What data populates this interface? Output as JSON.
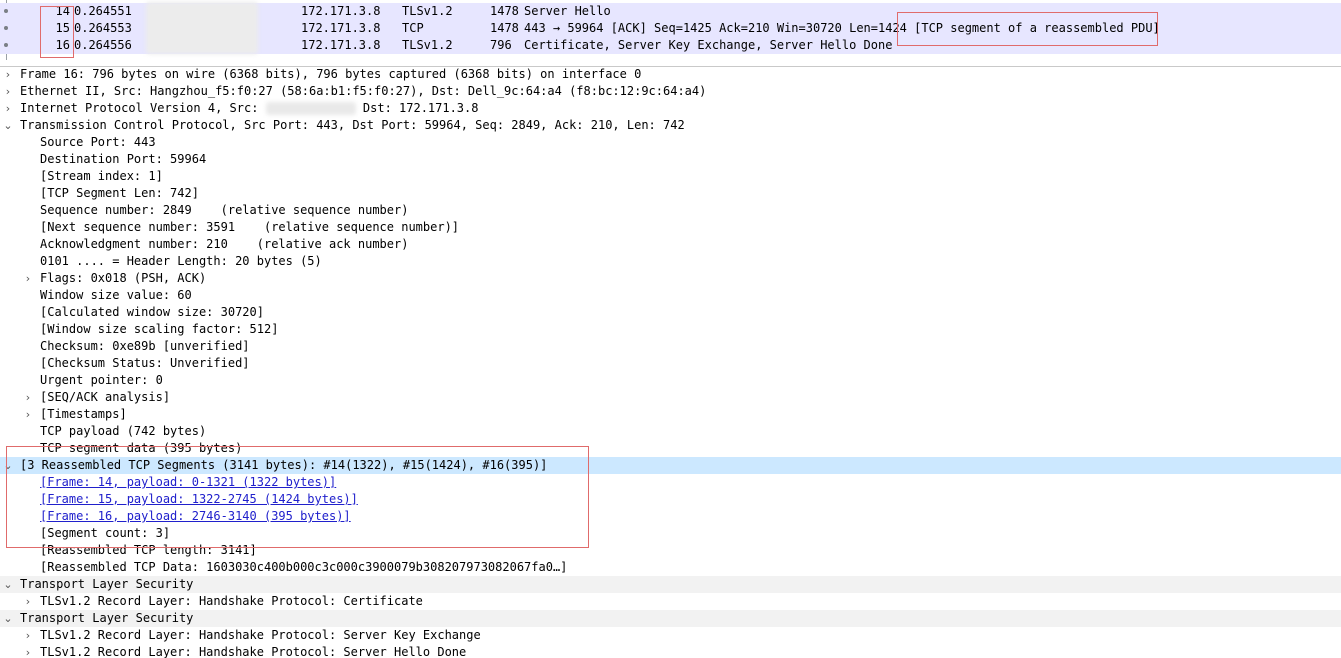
{
  "packet_list": {
    "rows": [
      {
        "no": "14",
        "time": "0.264551",
        "dst": "172.171.3.8",
        "proto": "TLSv1.2",
        "len": "1478",
        "info": "Server Hello"
      },
      {
        "no": "15",
        "time": "0.264553",
        "dst": "172.171.3.8",
        "proto": "TCP",
        "len": "1478",
        "info": "443 → 59964 [ACK] Seq=1425 Ack=210 Win=30720 Len=1424 [TCP segment of a reassembled PDU]"
      },
      {
        "no": "16",
        "time": "0.264556",
        "dst": "172.171.3.8",
        "proto": "TLSv1.2",
        "len": "796",
        "info": "Certificate, Server Key Exchange, Server Hello Done"
      }
    ]
  },
  "details": {
    "frame": "Frame 16: 796 bytes on wire (6368 bits), 796 bytes captured (6368 bits) on interface 0",
    "ethernet": "Ethernet II, Src: Hangzhou_f5:f0:27 (58:6a:b1:f5:f0:27), Dst: Dell_9c:64:a4 (f8:bc:12:9c:64:a4)",
    "ip_prefix": "Internet Protocol Version 4, Src:",
    "ip_dst": "Dst: 172.171.3.8",
    "tcp_header": "Transmission Control Protocol, Src Port: 443, Dst Port: 59964, Seq: 2849, Ack: 210, Len: 742",
    "tcp_fields": [
      "Source Port: 443",
      "Destination Port: 59964",
      "[Stream index: 1]",
      "[TCP Segment Len: 742]",
      "Sequence number: 2849    (relative sequence number)",
      "[Next sequence number: 3591    (relative sequence number)]",
      "Acknowledgment number: 210    (relative ack number)",
      "0101 .... = Header Length: 20 bytes (5)",
      "Flags: 0x018 (PSH, ACK)",
      "Window size value: 60",
      "[Calculated window size: 30720]",
      "[Window size scaling factor: 512]",
      "Checksum: 0xe89b [unverified]",
      "[Checksum Status: Unverified]",
      "Urgent pointer: 0",
      "[SEQ/ACK analysis]",
      "[Timestamps]",
      "TCP payload (742 bytes)",
      "TCP segment data (395 bytes)"
    ],
    "reassembled_header": "[3 Reassembled TCP Segments (3141 bytes): #14(1322), #15(1424), #16(395)]",
    "reassembled_links": [
      "[Frame: 14, payload: 0-1321 (1322 bytes)]",
      "[Frame: 15, payload: 1322-2745 (1424 bytes)]",
      "[Frame: 16, payload: 2746-3140 (395 bytes)]"
    ],
    "segment_count": "[Segment count: 3]",
    "reassembled_length": "[Reassembled TCP length: 3141]",
    "reassembled_data": "[Reassembled TCP Data: 1603030c400b000c3c000c3900079b308207973082067fa0…]",
    "tls1_header": "Transport Layer Security",
    "tls1_record": "TLSv1.2 Record Layer: Handshake Protocol: Certificate",
    "tls2_header": "Transport Layer Security",
    "tls2_record1": "TLSv1.2 Record Layer: Handshake Protocol: Server Key Exchange",
    "tls2_record2": "TLSv1.2 Record Layer: Handshake Protocol: Server Hello Done"
  },
  "icons": {
    "collapsed": "›",
    "expanded": "⌄"
  },
  "colors": {
    "selected_row": "#cce8ff",
    "packet_bg": "#e7e6ff",
    "annotation": "#e06b6b",
    "link": "#2020cc"
  }
}
